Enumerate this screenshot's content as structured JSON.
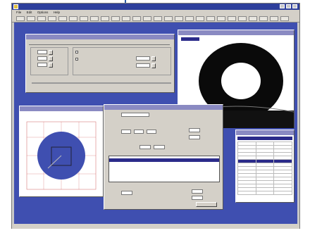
{
  "app": {
    "title": "",
    "menu": [
      {
        "label": "File"
      },
      {
        "label": "Edit"
      },
      {
        "label": "Options"
      },
      {
        "label": "Help"
      }
    ],
    "status_left": "",
    "status_right": "",
    "colors": {
      "desktop": "#3f4fb0",
      "titlebar": "#2e3f9c",
      "selection": "#2b2b8a",
      "drop": "#0a0a0a",
      "target_fill": "#3f4fb0"
    }
  },
  "icons": [
    "app-icon",
    "minimize-icon",
    "maximize-icon",
    "close-icon",
    "toolbar-icon"
  ]
}
